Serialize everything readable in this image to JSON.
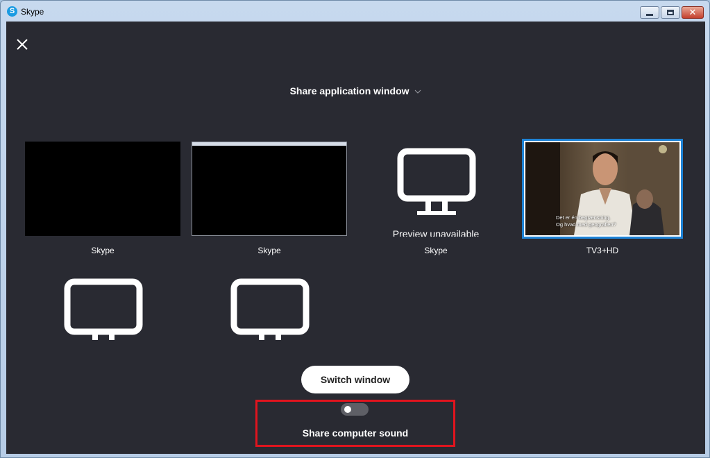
{
  "window": {
    "title": "Skype",
    "logo_letter": "S"
  },
  "share": {
    "header": "Share application window"
  },
  "tiles": [
    {
      "label": "Skype"
    },
    {
      "label": "Skype"
    },
    {
      "label": "Skype",
      "preview_text": "Preview unavailable"
    },
    {
      "label": "TV3+HD"
    }
  ],
  "video": {
    "subtitle_line1": "Det er én begrænsning.",
    "subtitle_line2": "Og hvad med geografien?"
  },
  "actions": {
    "switch_window": "Switch window",
    "share_sound_label": "Share computer sound",
    "share_sound_enabled": false
  },
  "colors": {
    "background": "#292a32",
    "selection": "#1e83d6",
    "highlight": "#e0141e",
    "toggle_off": "#5e5f66"
  }
}
